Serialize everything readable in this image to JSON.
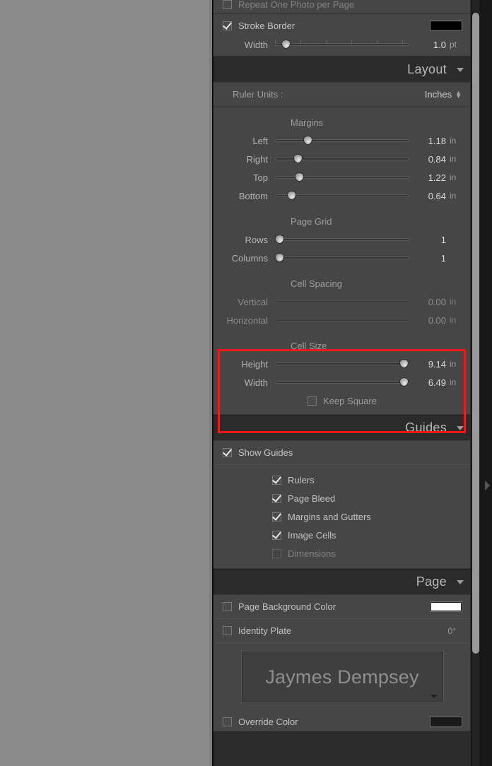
{
  "app": {
    "module": "Print",
    "panel": "right-panel"
  },
  "top_clipped_row": {
    "label": "Repeat One Photo per Page",
    "checked": false
  },
  "image_settings": {
    "stroke_border": {
      "label": "Stroke Border",
      "checked": true,
      "color": "#000000"
    },
    "width": {
      "label": "Width",
      "value": "1.0",
      "unit": "pt",
      "thumb_pct": 8
    }
  },
  "layout": {
    "title": "Layout",
    "ruler_units": {
      "label": "Ruler Units :",
      "value": "Inches"
    },
    "margins": {
      "title": "Margins",
      "rows": [
        {
          "label": "Left",
          "value": "1.18",
          "unit": "in",
          "thumb_pct": 24
        },
        {
          "label": "Right",
          "value": "0.84",
          "unit": "in",
          "thumb_pct": 17
        },
        {
          "label": "Top",
          "value": "1.22",
          "unit": "in",
          "thumb_pct": 18
        },
        {
          "label": "Bottom",
          "value": "0.64",
          "unit": "in",
          "thumb_pct": 12
        }
      ]
    },
    "page_grid": {
      "title": "Page Grid",
      "rows": [
        {
          "label": "Rows",
          "value": "1",
          "unit": "",
          "thumb_pct": 3
        },
        {
          "label": "Columns",
          "value": "1",
          "unit": "",
          "thumb_pct": 3
        }
      ]
    },
    "cell_spacing": {
      "title": "Cell Spacing",
      "rows": [
        {
          "label": "Vertical",
          "value": "0.00",
          "unit": "in",
          "disabled": true
        },
        {
          "label": "Horizontal",
          "value": "0.00",
          "unit": "in",
          "disabled": true
        }
      ]
    },
    "cell_size": {
      "title": "Cell Size",
      "rows": [
        {
          "label": "Height",
          "value": "9.14",
          "unit": "in",
          "thumb_pct": 96
        },
        {
          "label": "Width",
          "value": "6.49",
          "unit": "in",
          "thumb_pct": 96
        }
      ],
      "keep_square": {
        "label": "Keep Square",
        "checked": false
      }
    },
    "highlight_color": "#f01818"
  },
  "guides": {
    "title": "Guides",
    "show_guides": {
      "label": "Show Guides",
      "checked": true
    },
    "items": [
      {
        "label": "Rulers",
        "checked": true,
        "disabled": false
      },
      {
        "label": "Page Bleed",
        "checked": true,
        "disabled": false
      },
      {
        "label": "Margins and Gutters",
        "checked": true,
        "disabled": false
      },
      {
        "label": "Image Cells",
        "checked": true,
        "disabled": false
      },
      {
        "label": "Dimensions",
        "checked": false,
        "disabled": true
      }
    ]
  },
  "page": {
    "title": "Page",
    "background_color": {
      "label": "Page Background Color",
      "checked": false,
      "color": "#ffffff"
    },
    "identity_plate": {
      "label": "Identity Plate",
      "checked": false,
      "angle": "0°",
      "preview_text": "Jaymes Dempsey"
    },
    "override_color": {
      "label": "Override Color",
      "checked": false,
      "color": "#1a1a1a"
    }
  }
}
